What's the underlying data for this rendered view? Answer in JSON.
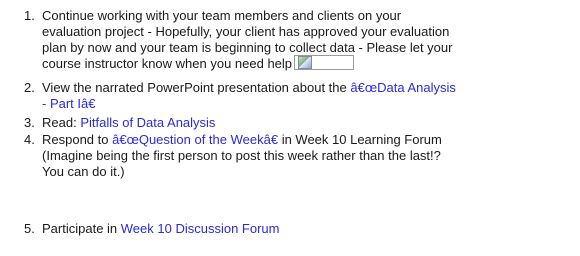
{
  "items": [
    {
      "number": "1.",
      "lines": [
        "Continue working with your team members and clients on your",
        "evaluation project - Hopefully, your client has approved your evaluation",
        "plan by now and your team is beginning to collect data - Please let your",
        "course instructor know when you need help"
      ],
      "widget_icon": "image-icon"
    },
    {
      "number": "2.",
      "prefix": "View the narrated PowerPoint presentation about the ",
      "link_line1": "â€œData Analysis",
      "link_line2": "- Part Iâ€"
    },
    {
      "number": "3.",
      "prefix": "Read: ",
      "link": "Pitfalls of Data Analysis"
    },
    {
      "number": "4.",
      "prefix": "Respond to ",
      "link": "â€œQuestion of the Weekâ€",
      "suffix": " in Week 10 Learning Forum",
      "line2": "(Imagine being the first person to post this week rather than the last!?",
      "line3": "You can do it.)"
    },
    {
      "number": "5.",
      "prefix": "Participate in ",
      "link": "Week 10 Discussion Forum"
    }
  ],
  "colors": {
    "link": "#2a2add",
    "text": "#1a1a1a"
  }
}
